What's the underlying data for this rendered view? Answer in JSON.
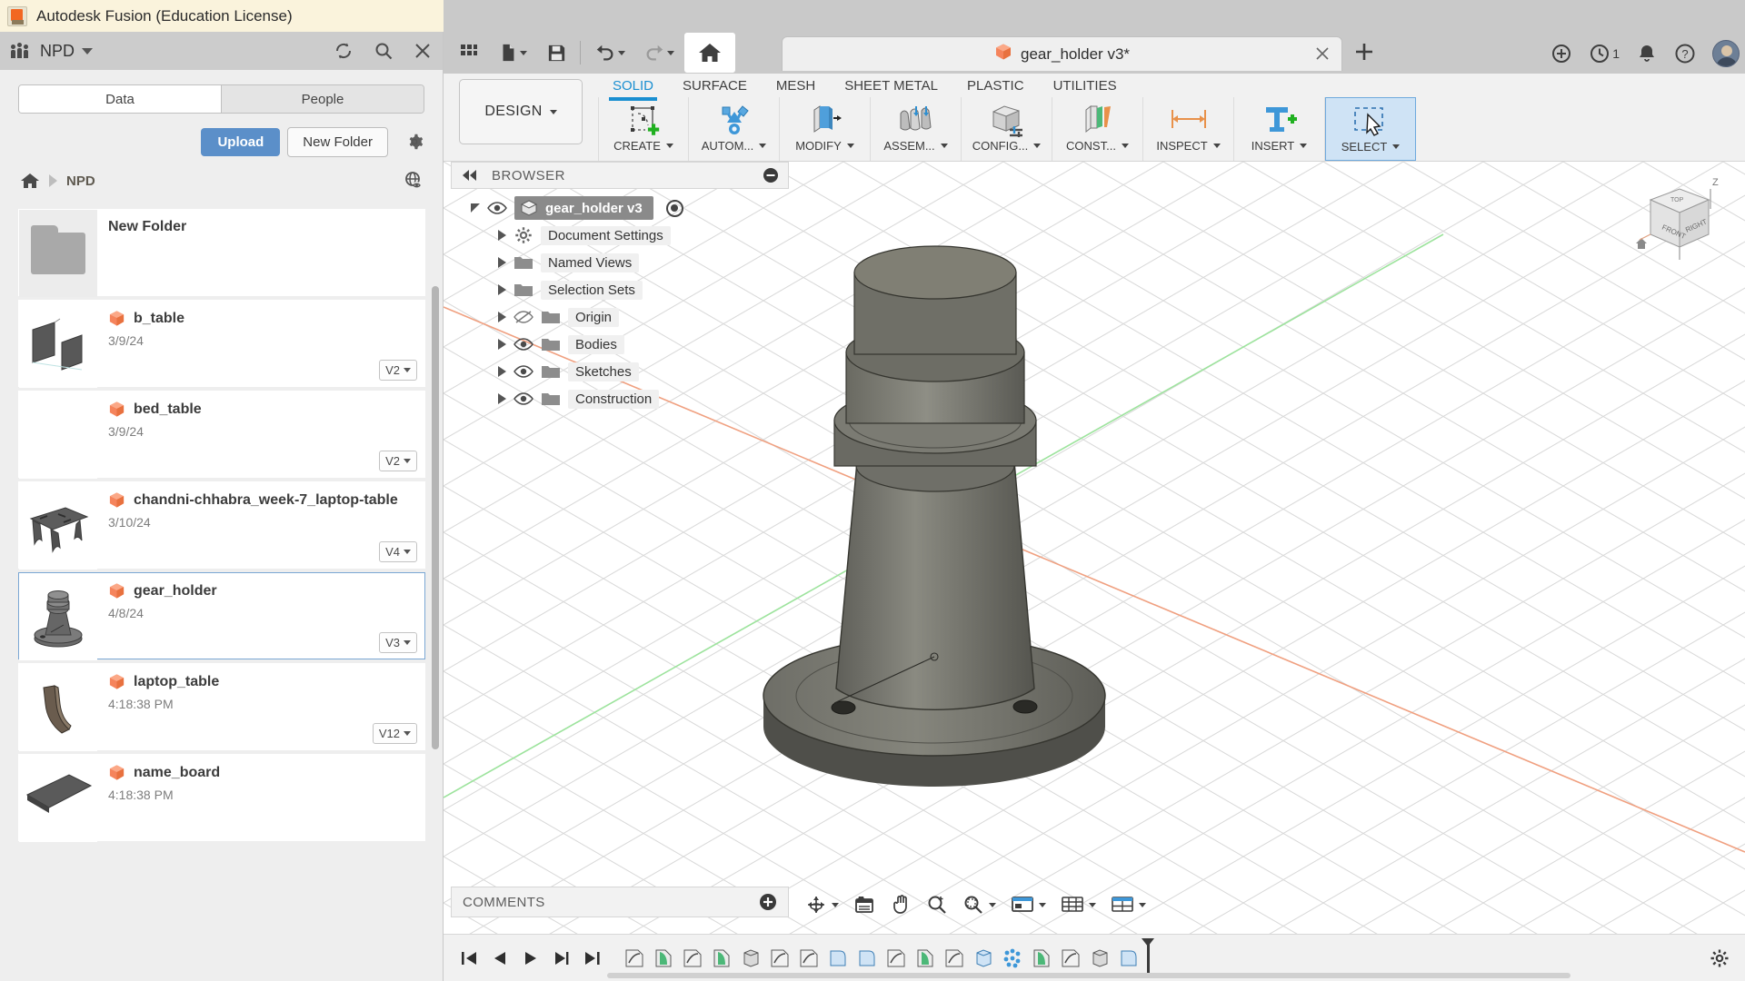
{
  "window": {
    "title": "Autodesk Fusion (Education License)",
    "logo_icon": "fusion-logo-icon",
    "minimize_icon": "minimize-icon",
    "maximize_icon": "maximize-icon",
    "close_icon": "close-icon"
  },
  "data_panel": {
    "hub_name": "NPD",
    "hub_icon": "people-icon",
    "hub_caret_icon": "chevron-down-icon",
    "refresh_icon": "refresh-icon",
    "search_icon": "search-icon",
    "close_panel_icon": "close-icon",
    "tabs": [
      {
        "label": "Data",
        "active": true
      },
      {
        "label": "People",
        "active": false
      }
    ],
    "upload_label": "Upload",
    "new_folder_label": "New Folder",
    "settings_icon": "gear-icon",
    "breadcrumb": {
      "home_icon": "home-icon",
      "separator_icon": "chevron-right-icon",
      "path": "NPD",
      "globe_icon": "globe-eye-icon"
    },
    "items": [
      {
        "name": "New Folder",
        "type": "folder",
        "date": "",
        "version": "",
        "thumb": "folder-thumbnail",
        "selected": false
      },
      {
        "name": "b_table",
        "type": "design",
        "date": "3/9/24",
        "version": "V2",
        "thumb": "b-table-thumbnail",
        "selected": false
      },
      {
        "name": "bed_table",
        "type": "design",
        "date": "3/9/24",
        "version": "V2",
        "thumb": "bed-table-thumbnail",
        "selected": false
      },
      {
        "name": "chandni-chhabra_week-7_laptop-table",
        "type": "design",
        "date": "3/10/24",
        "version": "V4",
        "thumb": "laptop-table-thumbnail",
        "selected": false
      },
      {
        "name": "gear_holder",
        "type": "design",
        "date": "4/8/24",
        "version": "V3",
        "thumb": "gear-holder-thumbnail",
        "selected": true
      },
      {
        "name": "laptop_table",
        "type": "design",
        "date": "4:18:38 PM",
        "version": "V12",
        "thumb": "laptop-table2-thumbnail",
        "selected": false
      },
      {
        "name": "name_board",
        "type": "design",
        "date": "4:18:38 PM",
        "version": "",
        "thumb": "name-board-thumbnail",
        "selected": false
      }
    ]
  },
  "quick_bar": {
    "items": [
      {
        "name": "grid-apps-icon",
        "label": ""
      },
      {
        "name": "new-file-icon",
        "label": "",
        "has_caret": true
      },
      {
        "name": "save-icon",
        "label": ""
      },
      {
        "name": "undo-icon",
        "label": "",
        "has_caret": true
      },
      {
        "name": "redo-icon",
        "label": "",
        "has_caret": true
      },
      {
        "name": "home-icon",
        "label": ""
      }
    ]
  },
  "document_tab": {
    "title": "gear_holder v3*",
    "cube_icon": "design-cube-icon",
    "close_icon": "close-icon",
    "add_tab_icon": "plus-icon"
  },
  "top_right": {
    "extensions_icon": "extensions-icon",
    "jobs_icon": "job-status-icon",
    "jobs_count": "1",
    "notifications_icon": "bell-icon",
    "help_icon": "help-icon",
    "avatar_icon": "avatar"
  },
  "ribbon": {
    "workspace_label": "DESIGN",
    "workspace_caret_icon": "chevron-down-icon",
    "tabs": [
      {
        "label": "SOLID",
        "active": true
      },
      {
        "label": "SURFACE",
        "active": false
      },
      {
        "label": "MESH",
        "active": false
      },
      {
        "label": "SHEET METAL",
        "active": false
      },
      {
        "label": "PLASTIC",
        "active": false
      },
      {
        "label": "UTILITIES",
        "active": false
      }
    ],
    "groups": [
      {
        "label": "CREATE",
        "icon": "create-sketch-icon",
        "caret": true,
        "selected": false
      },
      {
        "label": "AUTOM...",
        "icon": "automate-icon",
        "caret": true,
        "selected": false
      },
      {
        "label": "MODIFY",
        "icon": "modify-press-pull-icon",
        "caret": true,
        "selected": false
      },
      {
        "label": "ASSEM...",
        "icon": "assemble-icon",
        "caret": true,
        "selected": false
      },
      {
        "label": "CONFIG...",
        "icon": "configure-icon",
        "caret": true,
        "selected": false
      },
      {
        "label": "CONST...",
        "icon": "construct-icon",
        "caret": true,
        "selected": false
      },
      {
        "label": "INSPECT",
        "icon": "inspect-measure-icon",
        "caret": true,
        "selected": false
      },
      {
        "label": "INSERT",
        "icon": "insert-icon",
        "caret": true,
        "selected": false
      },
      {
        "label": "SELECT",
        "icon": "select-icon",
        "caret": true,
        "selected": true
      }
    ]
  },
  "browser": {
    "title": "BROWSER",
    "collapse_icon": "collapse-left-icon",
    "minimize_icon": "minus-circle-icon",
    "root": {
      "label": "gear_holder v3",
      "eye_icon": "eye-visible-icon",
      "doc_icon": "document-cube-icon",
      "expand_icon": "triangle-open-icon",
      "target_icon": "target-icon"
    },
    "nodes": [
      {
        "label": "Document Settings",
        "icon": "gear-icon",
        "eye": "none",
        "expand_icon": "triangle-collapsed-icon"
      },
      {
        "label": "Named Views",
        "icon": "folder-icon",
        "eye": "none",
        "expand_icon": "triangle-collapsed-icon"
      },
      {
        "label": "Selection Sets",
        "icon": "folder-icon",
        "eye": "none",
        "expand_icon": "triangle-collapsed-icon"
      },
      {
        "label": "Origin",
        "icon": "folder-icon",
        "eye": "hidden",
        "expand_icon": "triangle-collapsed-icon"
      },
      {
        "label": "Bodies",
        "icon": "folder-icon",
        "eye": "visible",
        "expand_icon": "triangle-collapsed-icon"
      },
      {
        "label": "Sketches",
        "icon": "folder-icon",
        "eye": "visible",
        "expand_icon": "triangle-collapsed-icon"
      },
      {
        "label": "Construction",
        "icon": "folder-icon",
        "eye": "visible",
        "expand_icon": "triangle-collapsed-icon"
      }
    ]
  },
  "viewcube": {
    "front_label": "FRONT",
    "right_label": "RIGHT",
    "top_label": "TOP",
    "axis_z": "Z",
    "home_icon": "home-icon"
  },
  "comments": {
    "label": "COMMENTS",
    "add_icon": "plus-circle-icon"
  },
  "navigation_bar": {
    "items": [
      {
        "name": "orbit-icon",
        "has_caret": true
      },
      {
        "name": "look-at-icon",
        "has_caret": false
      },
      {
        "name": "pan-icon",
        "has_caret": false
      },
      {
        "name": "zoom-icon",
        "has_caret": false
      },
      {
        "name": "zoom-window-icon",
        "has_caret": true
      },
      {
        "name": "display-settings-icon",
        "has_caret": true
      },
      {
        "name": "grid-snaps-icon",
        "has_caret": true
      },
      {
        "name": "viewports-icon",
        "has_caret": true
      }
    ]
  },
  "timeline": {
    "controls": [
      {
        "name": "go-to-beginning-icon"
      },
      {
        "name": "step-back-icon"
      },
      {
        "name": "play-icon"
      },
      {
        "name": "step-forward-icon"
      },
      {
        "name": "go-to-end-icon"
      }
    ],
    "features": [
      {
        "name": "sketch-feature-icon",
        "kind": "sketch"
      },
      {
        "name": "revolve-feature-icon",
        "kind": "revolve"
      },
      {
        "name": "sketch-feature-icon",
        "kind": "sketch"
      },
      {
        "name": "revolve-feature-icon",
        "kind": "revolve"
      },
      {
        "name": "extrude-feature-icon",
        "kind": "extrude"
      },
      {
        "name": "sketch-feature-icon",
        "kind": "sketch"
      },
      {
        "name": "sketch-feature-icon",
        "kind": "sketch"
      },
      {
        "name": "fillet-feature-icon",
        "kind": "fillet"
      },
      {
        "name": "fillet-feature-icon",
        "kind": "fillet"
      },
      {
        "name": "sketch-feature-icon",
        "kind": "sketch"
      },
      {
        "name": "revolve-feature-icon",
        "kind": "revolve"
      },
      {
        "name": "sketch-feature-icon",
        "kind": "sketch"
      },
      {
        "name": "extrude-feature-icon",
        "kind": "extrude"
      },
      {
        "name": "pattern-feature-icon",
        "kind": "pattern"
      },
      {
        "name": "revolve-feature-icon",
        "kind": "revolve"
      },
      {
        "name": "sketch-feature-icon",
        "kind": "sketch"
      },
      {
        "name": "extrude-feature-icon",
        "kind": "extrude"
      },
      {
        "name": "fillet-feature-icon",
        "kind": "fillet"
      }
    ],
    "settings_icon": "gear-icon"
  }
}
